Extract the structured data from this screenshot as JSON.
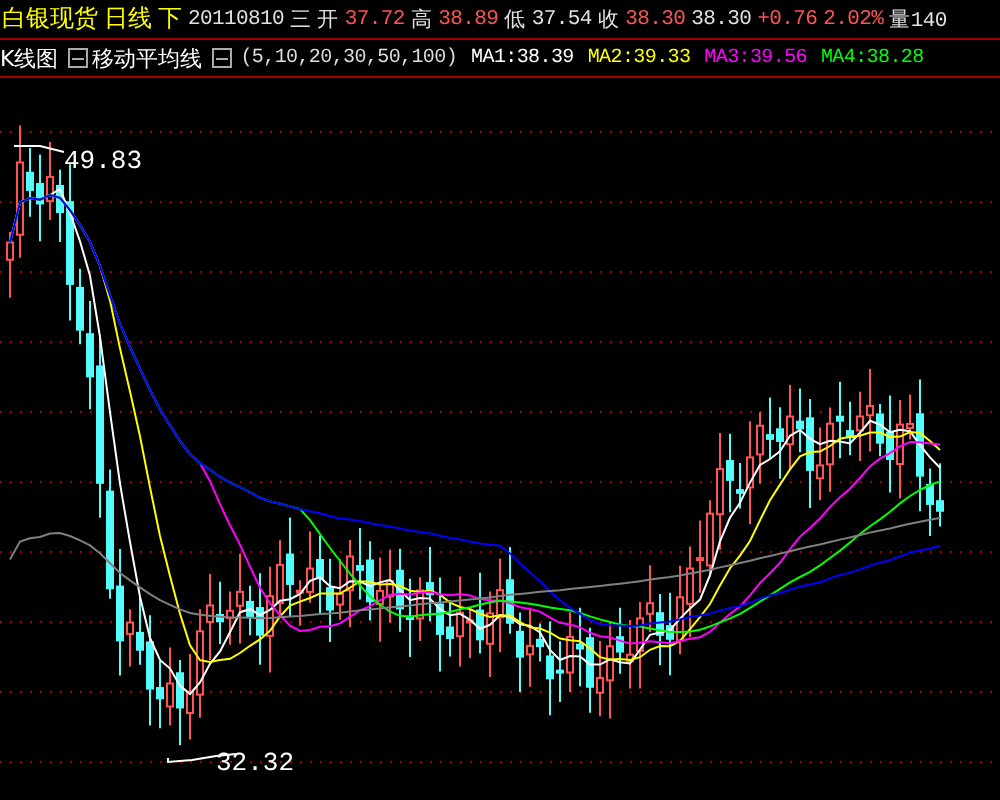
{
  "quote_bar": [
    {
      "text": "白银现货",
      "kind": "title"
    },
    {
      "text": "日线",
      "kind": "title"
    },
    {
      "text": "下",
      "kind": "title"
    },
    {
      "text": "20110810",
      "kind": "plain"
    },
    {
      "text": "三",
      "kind": "plain"
    },
    {
      "text": "开",
      "kind": "plain"
    },
    {
      "text": "37.72",
      "kind": "up"
    },
    {
      "text": "高",
      "kind": "plain"
    },
    {
      "text": "38.89",
      "kind": "up"
    },
    {
      "text": "低",
      "kind": "plain"
    },
    {
      "text": "37.54",
      "kind": "plain"
    },
    {
      "text": "收",
      "kind": "plain"
    },
    {
      "text": "38.30",
      "kind": "up"
    },
    {
      "text": "38.30",
      "kind": "plain"
    },
    {
      "text": "+0.76",
      "kind": "up"
    },
    {
      "text": "2.02%",
      "kind": "up"
    },
    {
      "text": "量140",
      "kind": "plain"
    }
  ],
  "indicator_bar": {
    "chart_label": "K线图",
    "indicator_name": "移动平均线",
    "params": "(5,10,20,30,50,100)",
    "averages": [
      {
        "text": "MA1:38.39",
        "color": "#ffffff"
      },
      {
        "text": "MA2:39.33",
        "color": "#ffff00"
      },
      {
        "text": "MA3:39.56",
        "color": "#ff00ff"
      },
      {
        "text": "MA4:38.28",
        "color": "#00ff00"
      }
    ]
  },
  "chart": {
    "high_label": "49.83",
    "low_label": "32.32"
  }
}
